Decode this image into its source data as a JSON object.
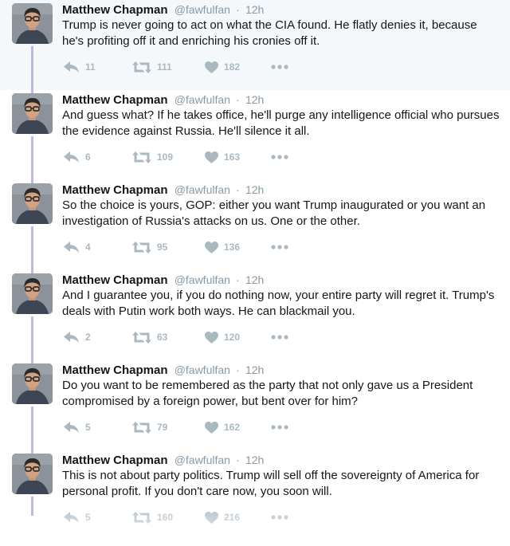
{
  "colors": {
    "thread_line": "#c4b5e8",
    "action_icon": "#aab8c2",
    "name": "#14171a",
    "meta": "#8899a6",
    "first_tweet_background": "#f5f8fa"
  },
  "icons": {
    "reply": "reply-icon",
    "retweet": "retweet-icon",
    "like": "heart-icon",
    "more": "more-icon"
  },
  "tweets": [
    {
      "name": "Matthew Chapman",
      "handle": "@fawfulfan",
      "separator": "·",
      "time": "12h",
      "text": "Trump is never going to act on what the CIA found. He flatly denies it, because he's profiting off it and enriching his cronies off it.",
      "replies": "11",
      "retweets": "111",
      "likes": "182"
    },
    {
      "name": "Matthew Chapman",
      "handle": "@fawfulfan",
      "separator": "·",
      "time": "12h",
      "text": "And guess what? If he takes office, he'll purge any intelligence official who pursues the evidence against Russia. He'll silence it all.",
      "replies": "6",
      "retweets": "109",
      "likes": "163"
    },
    {
      "name": "Matthew Chapman",
      "handle": "@fawfulfan",
      "separator": "·",
      "time": "12h",
      "text": "So the choice is yours, GOP: either you want Trump inaugurated or you want an investigation of Russia's attacks on us. One or the other.",
      "replies": "4",
      "retweets": "95",
      "likes": "136"
    },
    {
      "name": "Matthew Chapman",
      "handle": "@fawfulfan",
      "separator": "·",
      "time": "12h",
      "text": "And I guarantee you, if you do nothing now, your entire party will regret it. Trump's deals with Putin work both ways. He can blackmail you.",
      "replies": "2",
      "retweets": "63",
      "likes": "120"
    },
    {
      "name": "Matthew Chapman",
      "handle": "@fawfulfan",
      "separator": "·",
      "time": "12h",
      "text": "Do you want to be remembered as the party that not only gave us a President compromised by a foreign power, but bent over for him?",
      "replies": "5",
      "retweets": "79",
      "likes": "162"
    },
    {
      "name": "Matthew Chapman",
      "handle": "@fawfulfan",
      "separator": "·",
      "time": "12h",
      "text": "This is not about party politics. Trump will sell off the sovereignty of America for personal profit. If you don't care now, you soon will.",
      "replies": "5",
      "retweets": "160",
      "likes": "216"
    }
  ]
}
